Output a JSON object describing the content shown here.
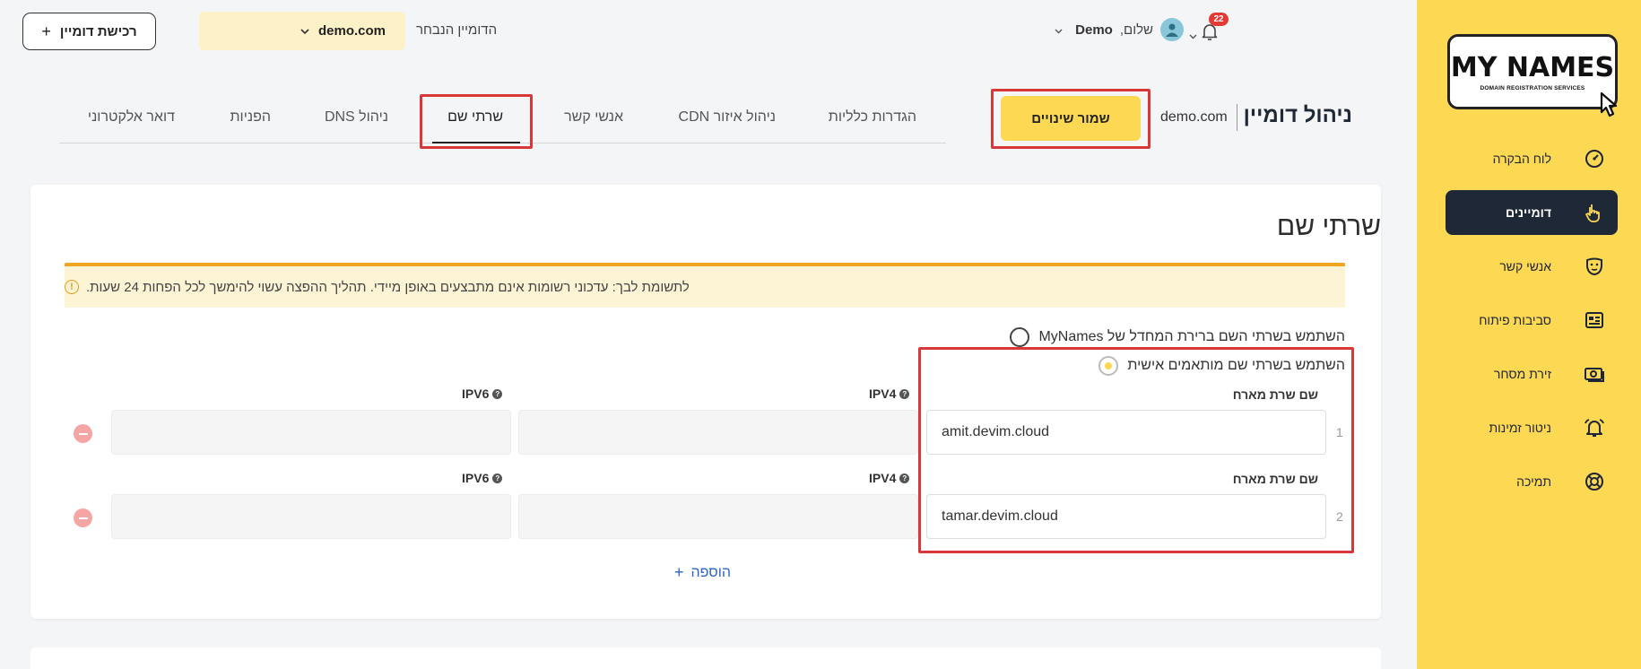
{
  "sidebar": {
    "logo_text": "MY NAMES",
    "logo_sub": "DOMAIN REGISTRATION SERVICES",
    "items": [
      {
        "label": "לוח הבקרה",
        "icon": "dashboard-gauge-icon"
      },
      {
        "label": "דומיינים",
        "icon": "pointer-hand-icon",
        "active": true
      },
      {
        "label": "אנשי קשר",
        "icon": "contacts-mask-icon"
      },
      {
        "label": "סביבות פיתוח",
        "icon": "dev-environments-icon"
      },
      {
        "label": "זירת מסחר",
        "icon": "marketplace-cash-icon"
      },
      {
        "label": "ניטור זמינות",
        "icon": "alarm-bell-icon"
      },
      {
        "label": "תמיכה",
        "icon": "lifebuoy-icon"
      }
    ]
  },
  "header": {
    "greeting": "שלום,",
    "user_name": "Demo",
    "notifications_count": "22",
    "selected_domain_label": "הדומיין הנבחר",
    "selected_domain": "demo.com",
    "buy_domain": "רכישת דומיין"
  },
  "page": {
    "title": "ניהול דומיין",
    "domain": "demo.com",
    "save_button": "שמור שינויים",
    "tabs": [
      {
        "label": "הגדרות כלליות"
      },
      {
        "label": "ניהול איזור CDN"
      },
      {
        "label": "אנשי קשר"
      },
      {
        "label": "שרתי שם",
        "active": true
      },
      {
        "label": "ניהול DNS"
      },
      {
        "label": "הפניות"
      },
      {
        "label": "דואר אלקטרוני"
      }
    ]
  },
  "nameservers": {
    "heading": "שרתי שם",
    "alert": "לתשומת לבך: עדכוני רשומות אינם מתבצעים באופן מיידי. תהליך ההפצה עשוי להימשך לכל הפחות 24 שעות.",
    "option_default": "השתמש בשרתי השם ברירת המחדל של MyNames",
    "option_custom": "השתמש בשרתי שם מותאמים אישית",
    "host_label": "שם שרת מארח",
    "ipv4_label": "IPV4",
    "ipv6_label": "IPV6",
    "rows": [
      {
        "num": "1",
        "host": "amit.devim.cloud",
        "ipv4": "",
        "ipv6": ""
      },
      {
        "num": "2",
        "host": "tamar.devim.cloud",
        "ipv4": "",
        "ipv6": ""
      }
    ],
    "add_label": "הוספה"
  },
  "colors": {
    "sidebar_bg": "#fcd853",
    "accent": "#fcd853",
    "active_nav": "#1f2836",
    "highlight_frame": "#d9383b",
    "alert_border": "#f0a41f",
    "link": "#2a66c8"
  }
}
